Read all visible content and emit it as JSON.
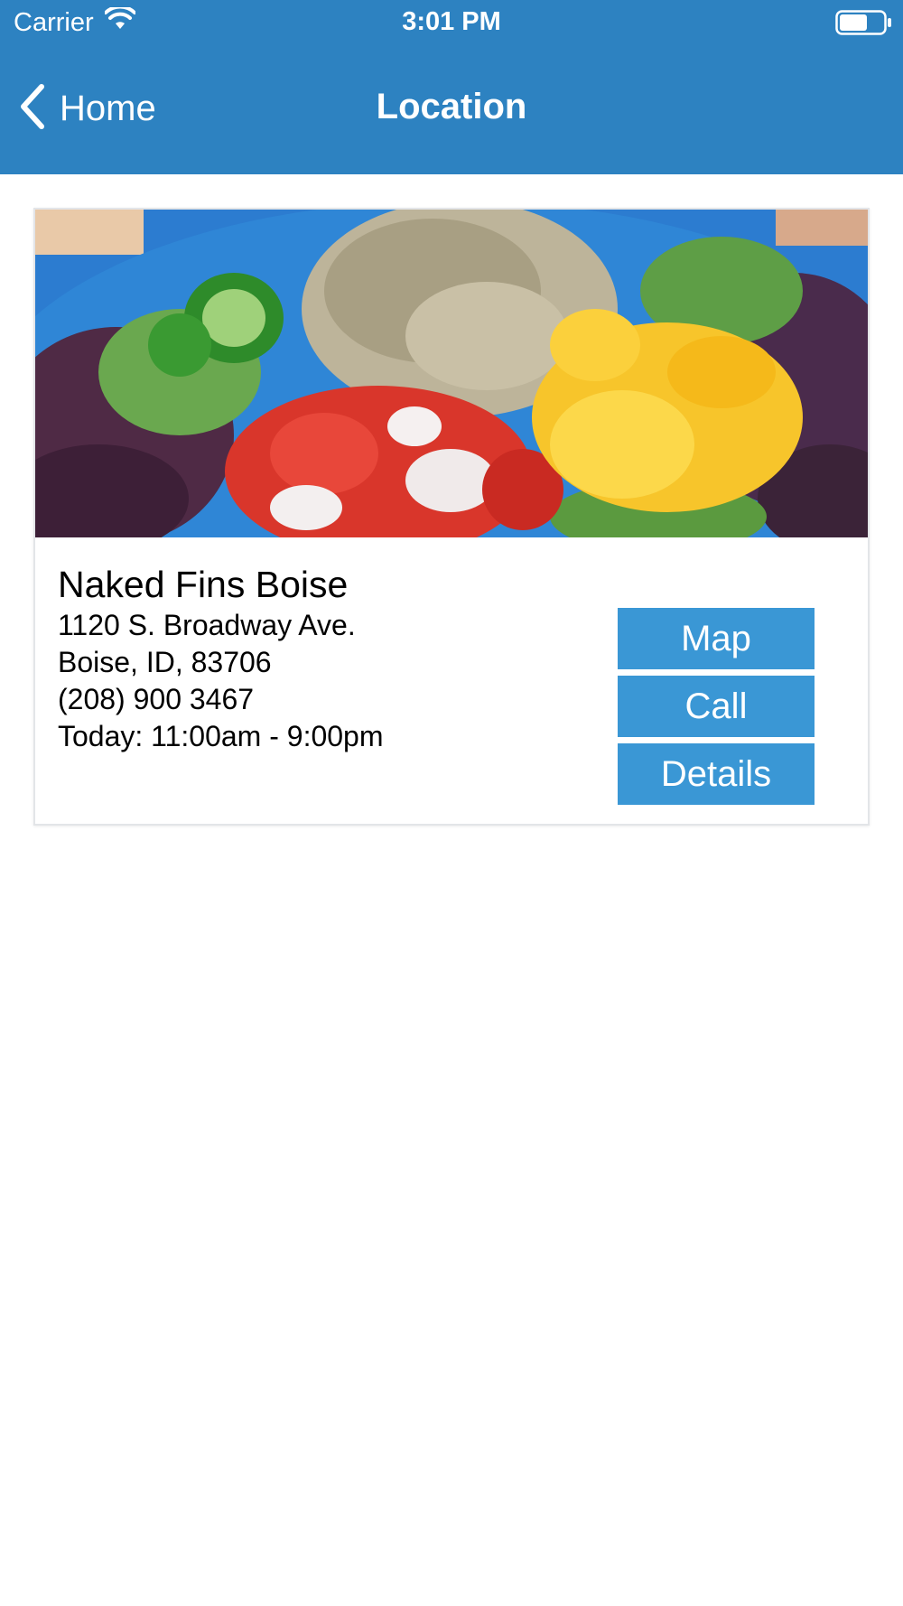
{
  "status_bar": {
    "carrier": "Carrier",
    "time": "3:01 PM",
    "wifi_icon": "wifi-icon",
    "battery_icon": "battery-icon"
  },
  "nav": {
    "back_label": "Home",
    "back_icon": "chevron-left-icon",
    "title": "Location"
  },
  "location": {
    "image": "food-photo",
    "name": "Naked Fins Boise",
    "address_line1": "1120 S. Broadway Ave.",
    "address_line2": "Boise, ID, 83706",
    "phone": "(208) 900 3467",
    "hours": "Today: 11:00am - 9:00pm"
  },
  "actions": {
    "map_label": "Map",
    "call_label": "Call",
    "details_label": "Details"
  },
  "colors": {
    "header": "#2d82c1",
    "button": "#3a97d5",
    "card_border": "#e3e5e8"
  }
}
